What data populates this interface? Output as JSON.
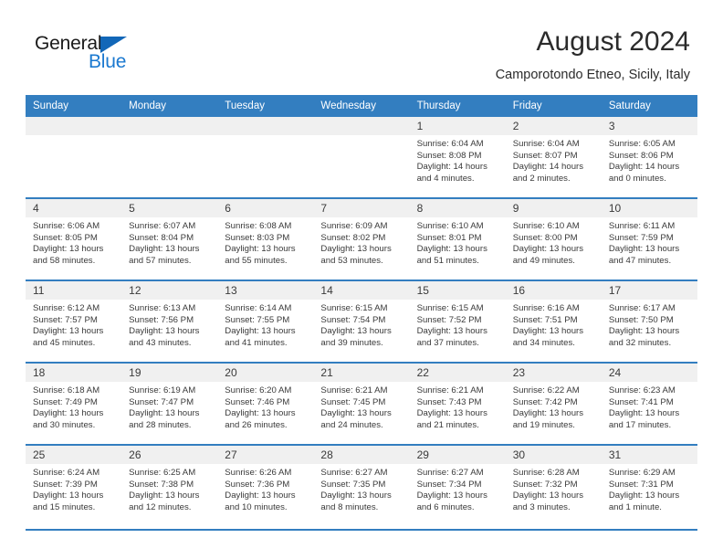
{
  "brand": {
    "name_top": "General",
    "name_bottom": "Blue",
    "triangle_color": "#1267b8",
    "blue_color": "#1b79d0"
  },
  "header": {
    "title": "August 2024",
    "subtitle": "Camporotondo Etneo, Sicily, Italy"
  },
  "theme": {
    "header_bg": "#337ec0",
    "daynum_bg": "#f0f0f0",
    "text": "#3a3a3a"
  },
  "weekday_headers": [
    "Sunday",
    "Monday",
    "Tuesday",
    "Wednesday",
    "Thursday",
    "Friday",
    "Saturday"
  ],
  "weeks": [
    [
      {
        "day": "",
        "empty": true
      },
      {
        "day": "",
        "empty": true
      },
      {
        "day": "",
        "empty": true
      },
      {
        "day": "",
        "empty": true
      },
      {
        "day": "1",
        "sunrise": "Sunrise: 6:04 AM",
        "sunset": "Sunset: 8:08 PM",
        "daylight": "Daylight: 14 hours and 4 minutes."
      },
      {
        "day": "2",
        "sunrise": "Sunrise: 6:04 AM",
        "sunset": "Sunset: 8:07 PM",
        "daylight": "Daylight: 14 hours and 2 minutes."
      },
      {
        "day": "3",
        "sunrise": "Sunrise: 6:05 AM",
        "sunset": "Sunset: 8:06 PM",
        "daylight": "Daylight: 14 hours and 0 minutes."
      }
    ],
    [
      {
        "day": "4",
        "sunrise": "Sunrise: 6:06 AM",
        "sunset": "Sunset: 8:05 PM",
        "daylight": "Daylight: 13 hours and 58 minutes."
      },
      {
        "day": "5",
        "sunrise": "Sunrise: 6:07 AM",
        "sunset": "Sunset: 8:04 PM",
        "daylight": "Daylight: 13 hours and 57 minutes."
      },
      {
        "day": "6",
        "sunrise": "Sunrise: 6:08 AM",
        "sunset": "Sunset: 8:03 PM",
        "daylight": "Daylight: 13 hours and 55 minutes."
      },
      {
        "day": "7",
        "sunrise": "Sunrise: 6:09 AM",
        "sunset": "Sunset: 8:02 PM",
        "daylight": "Daylight: 13 hours and 53 minutes."
      },
      {
        "day": "8",
        "sunrise": "Sunrise: 6:10 AM",
        "sunset": "Sunset: 8:01 PM",
        "daylight": "Daylight: 13 hours and 51 minutes."
      },
      {
        "day": "9",
        "sunrise": "Sunrise: 6:10 AM",
        "sunset": "Sunset: 8:00 PM",
        "daylight": "Daylight: 13 hours and 49 minutes."
      },
      {
        "day": "10",
        "sunrise": "Sunrise: 6:11 AM",
        "sunset": "Sunset: 7:59 PM",
        "daylight": "Daylight: 13 hours and 47 minutes."
      }
    ],
    [
      {
        "day": "11",
        "sunrise": "Sunrise: 6:12 AM",
        "sunset": "Sunset: 7:57 PM",
        "daylight": "Daylight: 13 hours and 45 minutes."
      },
      {
        "day": "12",
        "sunrise": "Sunrise: 6:13 AM",
        "sunset": "Sunset: 7:56 PM",
        "daylight": "Daylight: 13 hours and 43 minutes."
      },
      {
        "day": "13",
        "sunrise": "Sunrise: 6:14 AM",
        "sunset": "Sunset: 7:55 PM",
        "daylight": "Daylight: 13 hours and 41 minutes."
      },
      {
        "day": "14",
        "sunrise": "Sunrise: 6:15 AM",
        "sunset": "Sunset: 7:54 PM",
        "daylight": "Daylight: 13 hours and 39 minutes."
      },
      {
        "day": "15",
        "sunrise": "Sunrise: 6:15 AM",
        "sunset": "Sunset: 7:52 PM",
        "daylight": "Daylight: 13 hours and 37 minutes."
      },
      {
        "day": "16",
        "sunrise": "Sunrise: 6:16 AM",
        "sunset": "Sunset: 7:51 PM",
        "daylight": "Daylight: 13 hours and 34 minutes."
      },
      {
        "day": "17",
        "sunrise": "Sunrise: 6:17 AM",
        "sunset": "Sunset: 7:50 PM",
        "daylight": "Daylight: 13 hours and 32 minutes."
      }
    ],
    [
      {
        "day": "18",
        "sunrise": "Sunrise: 6:18 AM",
        "sunset": "Sunset: 7:49 PM",
        "daylight": "Daylight: 13 hours and 30 minutes."
      },
      {
        "day": "19",
        "sunrise": "Sunrise: 6:19 AM",
        "sunset": "Sunset: 7:47 PM",
        "daylight": "Daylight: 13 hours and 28 minutes."
      },
      {
        "day": "20",
        "sunrise": "Sunrise: 6:20 AM",
        "sunset": "Sunset: 7:46 PM",
        "daylight": "Daylight: 13 hours and 26 minutes."
      },
      {
        "day": "21",
        "sunrise": "Sunrise: 6:21 AM",
        "sunset": "Sunset: 7:45 PM",
        "daylight": "Daylight: 13 hours and 24 minutes."
      },
      {
        "day": "22",
        "sunrise": "Sunrise: 6:21 AM",
        "sunset": "Sunset: 7:43 PM",
        "daylight": "Daylight: 13 hours and 21 minutes."
      },
      {
        "day": "23",
        "sunrise": "Sunrise: 6:22 AM",
        "sunset": "Sunset: 7:42 PM",
        "daylight": "Daylight: 13 hours and 19 minutes."
      },
      {
        "day": "24",
        "sunrise": "Sunrise: 6:23 AM",
        "sunset": "Sunset: 7:41 PM",
        "daylight": "Daylight: 13 hours and 17 minutes."
      }
    ],
    [
      {
        "day": "25",
        "sunrise": "Sunrise: 6:24 AM",
        "sunset": "Sunset: 7:39 PM",
        "daylight": "Daylight: 13 hours and 15 minutes."
      },
      {
        "day": "26",
        "sunrise": "Sunrise: 6:25 AM",
        "sunset": "Sunset: 7:38 PM",
        "daylight": "Daylight: 13 hours and 12 minutes."
      },
      {
        "day": "27",
        "sunrise": "Sunrise: 6:26 AM",
        "sunset": "Sunset: 7:36 PM",
        "daylight": "Daylight: 13 hours and 10 minutes."
      },
      {
        "day": "28",
        "sunrise": "Sunrise: 6:27 AM",
        "sunset": "Sunset: 7:35 PM",
        "daylight": "Daylight: 13 hours and 8 minutes."
      },
      {
        "day": "29",
        "sunrise": "Sunrise: 6:27 AM",
        "sunset": "Sunset: 7:34 PM",
        "daylight": "Daylight: 13 hours and 6 minutes."
      },
      {
        "day": "30",
        "sunrise": "Sunrise: 6:28 AM",
        "sunset": "Sunset: 7:32 PM",
        "daylight": "Daylight: 13 hours and 3 minutes."
      },
      {
        "day": "31",
        "sunrise": "Sunrise: 6:29 AM",
        "sunset": "Sunset: 7:31 PM",
        "daylight": "Daylight: 13 hours and 1 minute."
      }
    ]
  ]
}
